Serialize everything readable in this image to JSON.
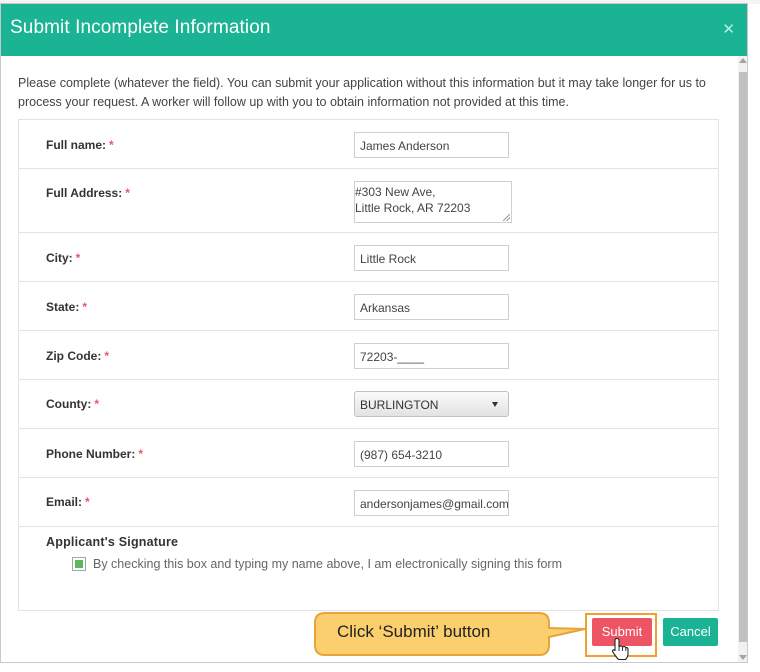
{
  "modal": {
    "title": "Submit Incomplete Information",
    "close_icon": "close-icon"
  },
  "intro_text": "Please complete (whatever the field). You can submit your application without this information but it may take longer for us to process your request. A worker will follow up with you to obtain information not provided at this time.",
  "form": {
    "required_mark": "*",
    "full_name": {
      "label": "Full name:",
      "value": "James Anderson"
    },
    "full_address": {
      "label": "Full Address:",
      "line1": "#303 New Ave,",
      "line2": "Little Rock, AR 72203"
    },
    "city": {
      "label": "City:",
      "value": "Little Rock"
    },
    "state": {
      "label": "State:",
      "value": "Arkansas"
    },
    "zip": {
      "label": "Zip Code:",
      "value": "72203-____"
    },
    "county": {
      "label": "County:",
      "value": "BURLINGTON"
    },
    "phone": {
      "label": "Phone Number:",
      "value": "(987) 654-3210"
    },
    "email": {
      "label": "Email:",
      "value": "andersonjames@gmail.com"
    }
  },
  "signature": {
    "title": "Applicant's Signature",
    "checkbox_label": "By checking this box and typing my name above, I am electronically signing this form",
    "checked": true
  },
  "buttons": {
    "submit": "Submit",
    "cancel": "Cancel"
  },
  "callout": {
    "text": "Click ‘Submit’ button"
  },
  "colors": {
    "header": "#1ab394",
    "submit": "#ed5565",
    "cancel": "#1ab394",
    "required": "#ed5565",
    "callout_fill": "#fbcf6e",
    "callout_border": "#e8a33a",
    "checkbox_fill": "#5cb85c"
  }
}
